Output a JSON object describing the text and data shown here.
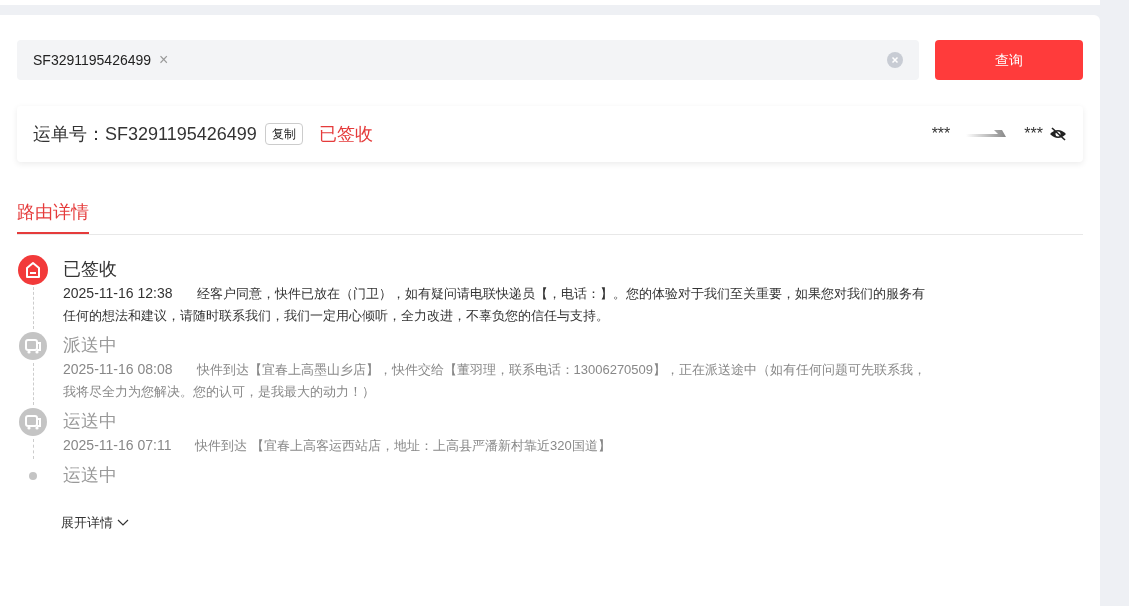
{
  "search": {
    "value": "SF3291195426499",
    "chip_close": "×",
    "button": "查询"
  },
  "waybill": {
    "label": "运单号：SF3291195426499",
    "copy": "复制",
    "status": "已签收",
    "from": "***",
    "to": "***",
    "hidden": true
  },
  "tabs": [
    {
      "label": "路由详情",
      "selected": true
    }
  ],
  "events": [
    {
      "kind": "signed",
      "active": true,
      "title": "已签收",
      "time": "2025-11-16 12:38",
      "text": "经客户同意，快件已放在（门卫），如有疑问请电联快递员【，电话：】。您的体验对于我们至关重要，如果您对我们的服务有任何的想法和建议，请随时联系我们，我们一定用心倾听，全力改进，不辜负您的信任与支持。"
    },
    {
      "kind": "truck",
      "active": false,
      "title": "派送中",
      "time": "2025-11-16 08:08",
      "text": "快件到达【宜春上高墨山乡店】，快件交给【董羽理，联系电话：13006270509】，正在派送途中（如有任何问题可先联系我，我将尽全力为您解决。您的认可，是我最大的动力！）"
    },
    {
      "kind": "truck",
      "active": false,
      "title": "运送中",
      "time": "2025-11-16 07:11",
      "text": "快件到达 【宜春上高客运西站店，地址：上高县严潘新村靠近320国道】"
    },
    {
      "kind": "dot",
      "active": false,
      "title": "运送中"
    }
  ],
  "expand": "展开详情"
}
